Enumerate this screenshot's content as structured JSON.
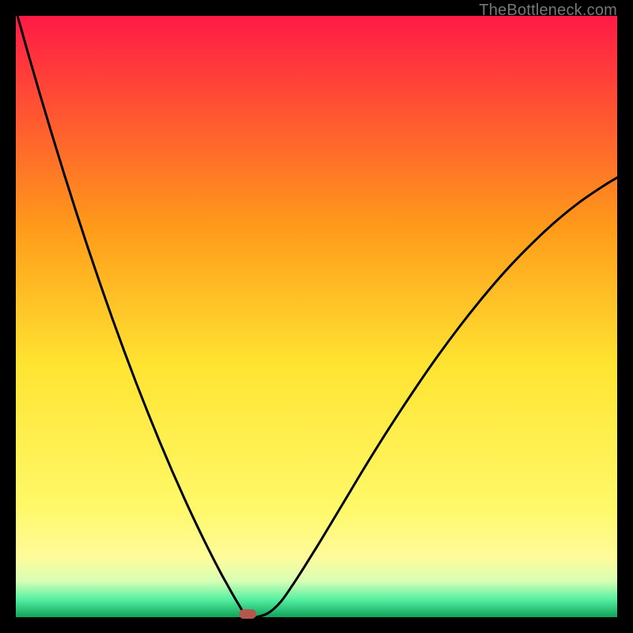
{
  "watermark": "TheBottleneck.com",
  "colors": {
    "black": "#000000",
    "curve": "#000000",
    "marker": "#b4574d",
    "grad_top": "#ff1a46",
    "grad_mid_high": "#ff9a1a",
    "grad_mid": "#ffe431",
    "grad_low_yellow": "#fffb86",
    "grad_bottom_green": "#18e07a",
    "grad_bottom_dark_green": "#0ea45a"
  },
  "chart_data": {
    "type": "line",
    "title": "",
    "xlabel": "",
    "ylabel": "",
    "xlim": [
      0,
      100
    ],
    "ylim": [
      0,
      100
    ],
    "curve_minimum_x": 38,
    "x": [
      0,
      2,
      4,
      6,
      8,
      10,
      12,
      14,
      16,
      18,
      20,
      22,
      24,
      26,
      28,
      30,
      32,
      34,
      35,
      36,
      37,
      38,
      39,
      40,
      42,
      44,
      46,
      48,
      50,
      52,
      55,
      58,
      62,
      66,
      70,
      74,
      78,
      82,
      86,
      90,
      94,
      98,
      100
    ],
    "y": [
      101,
      93.9,
      87,
      80.3,
      73.8,
      67.5,
      61.4,
      55.5,
      49.8,
      44.3,
      39,
      33.9,
      29,
      24.3,
      19.8,
      15.5,
      11.4,
      7.5,
      5.7,
      3.9,
      2.2,
      0.6,
      0.0,
      0.0,
      0.7,
      2.5,
      5.3,
      8.4,
      11.6,
      14.9,
      19.9,
      24.9,
      31.3,
      37.4,
      43.2,
      48.6,
      53.6,
      58.2,
      62.3,
      66.0,
      69.2,
      71.9,
      73.1
    ],
    "marker": {
      "x": 38.5,
      "y": 0.0
    }
  }
}
